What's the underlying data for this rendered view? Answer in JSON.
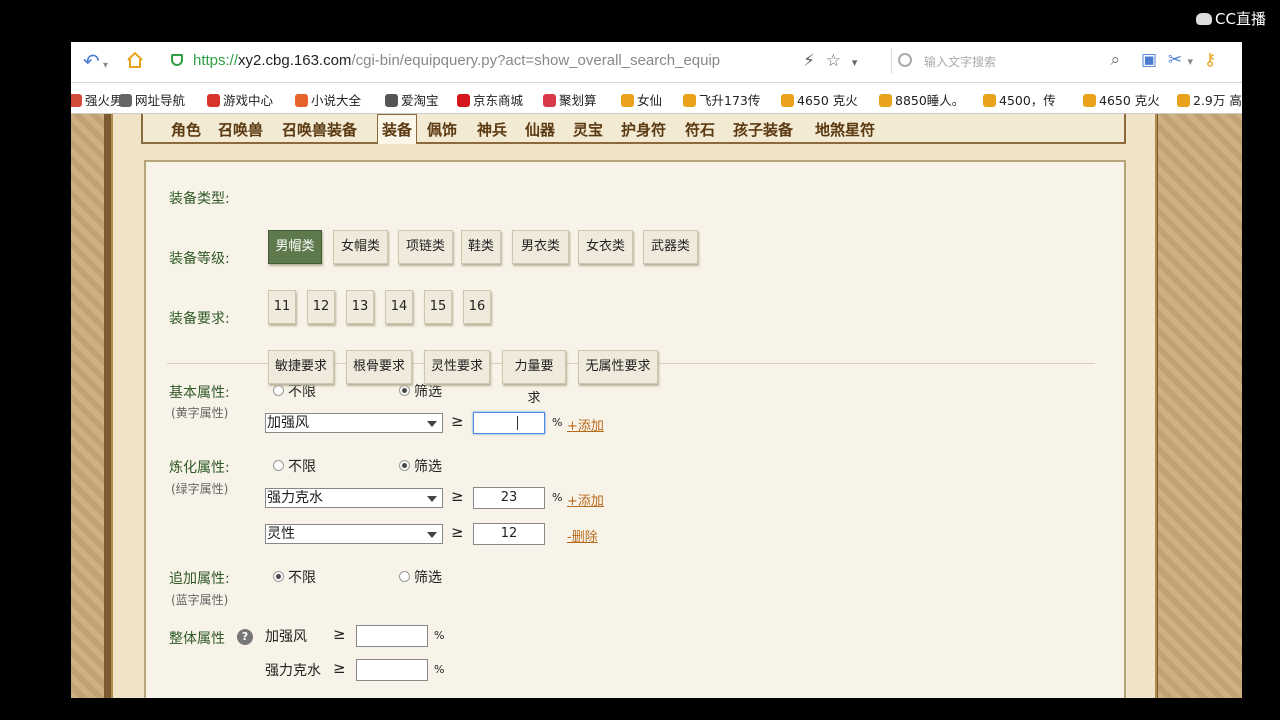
{
  "overlay": {
    "brand": "CC直播"
  },
  "browser": {
    "url_scheme": "https://",
    "url_domain": "xy2.cbg.163.com",
    "url_path": "/cgi-bin/equipquery.py?act=show_overall_search_equip",
    "search_placeholder": "输入文字搜索"
  },
  "bookmarks": [
    {
      "label": "强火男",
      "color": "#d24b3b"
    },
    {
      "label": "网址导航",
      "color": "#666666"
    },
    {
      "label": "游戏中心",
      "color": "#d9342b"
    },
    {
      "label": "小说大全",
      "color": "#e8622c"
    },
    {
      "label": "爱淘宝",
      "color": "#555555"
    },
    {
      "label": "京东商城",
      "color": "#d4151b"
    },
    {
      "label": "聚划算",
      "color": "#d93a4a"
    },
    {
      "label": "女仙",
      "color": "#e8a21b"
    },
    {
      "label": "飞升173传",
      "color": "#e8a21b"
    },
    {
      "label": "4650 克火",
      "color": "#e8a21b"
    },
    {
      "label": "8850睡人。",
      "color": "#e8a21b"
    },
    {
      "label": "4500，传",
      "color": "#e8a21b"
    },
    {
      "label": "4650 克火",
      "color": "#e8a21b"
    },
    {
      "label": "2.9万 高",
      "color": "#e8a21b"
    }
  ],
  "tabs": [
    "角色",
    "召唤兽",
    "召唤兽装备",
    "装备",
    "佩饰",
    "神兵",
    "仙器",
    "灵宝",
    "护身符",
    "符石",
    "孩子装备",
    "地煞星符"
  ],
  "active_tab": "装备",
  "form": {
    "type_label": "装备类型:",
    "types": [
      "男帽类",
      "女帽类",
      "项链类",
      "鞋类",
      "男衣类",
      "女衣类",
      "武器类"
    ],
    "level_label": "装备等级:",
    "levels": [
      "11",
      "12",
      "13",
      "14",
      "15",
      "16"
    ],
    "req_label": "装备要求:",
    "reqs": [
      "敏捷要求",
      "根骨要求",
      "灵性要求",
      "力量要求",
      "无属性要求"
    ],
    "opt_unlimited": "不限",
    "opt_filter": "筛选",
    "basic_label": "基本属性:",
    "basic_sub": "(黄字属性)",
    "basic_select": "加强风",
    "basic_value": "",
    "lianhua_label": "炼化属性:",
    "lianhua_sub": "(绿字属性)",
    "lianhua_rows": [
      {
        "select": "强力克水",
        "value": "23",
        "action": "+添加"
      },
      {
        "select": "灵性",
        "value": "12",
        "action": "-删除"
      }
    ],
    "add_label": "追加属性:",
    "add_sub": "(蓝字属性)",
    "overall_label": "整体属性",
    "overall_rows": [
      "加强风",
      "强力克水"
    ],
    "ge": "≥",
    "pct": "%",
    "add_link": "+添加"
  }
}
